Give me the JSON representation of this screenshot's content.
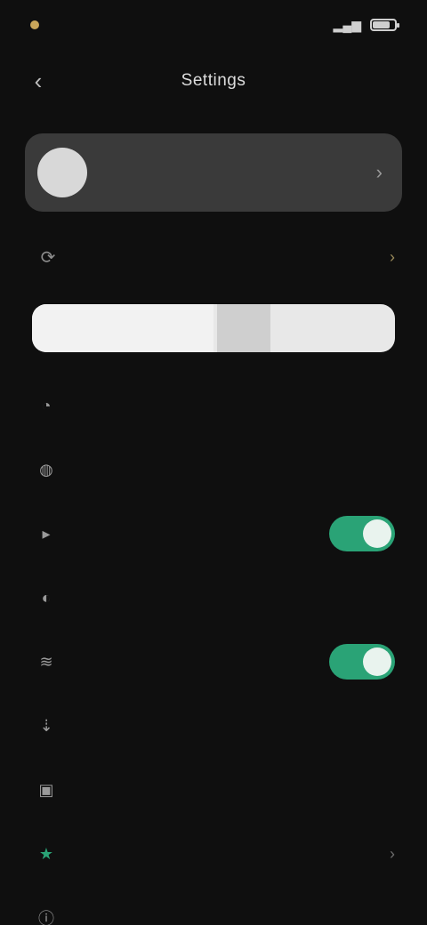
{
  "status_bar": {
    "time": "",
    "battery_level": 0.8
  },
  "header": {
    "title": "Settings",
    "back_icon": "arrow-left-icon"
  },
  "account": {
    "name": "",
    "chevron_icon": "chevron-right-icon"
  },
  "sync": {
    "title": "",
    "subtitle": "",
    "icon": "sync-icon"
  },
  "storage": {
    "used_fraction": 0.5
  },
  "settings": [
    {
      "id": "notifications",
      "icon": "bell-icon",
      "label": "",
      "value": "",
      "control": "none"
    },
    {
      "id": "language",
      "icon": "globe-icon",
      "label": "",
      "value": "",
      "control": "value"
    },
    {
      "id": "auto-play",
      "icon": "play-icon",
      "label": "",
      "value": "",
      "control": "toggle",
      "toggle_on": true
    },
    {
      "id": "theme",
      "icon": "moon-icon",
      "label": "",
      "value": "",
      "control": "value"
    },
    {
      "id": "haptics",
      "icon": "vibrate-icon",
      "label": "",
      "value": "",
      "control": "toggle",
      "toggle_on": true
    },
    {
      "id": "downloads",
      "icon": "download-icon",
      "label": "",
      "value": "",
      "control": "none"
    },
    {
      "id": "privacy",
      "icon": "lock-icon",
      "label": "",
      "value": "",
      "control": "none"
    },
    {
      "id": "premium",
      "icon": "star-icon",
      "label": "",
      "value": "",
      "control": "chevron"
    },
    {
      "id": "about",
      "icon": "info-icon",
      "label": "",
      "value": "",
      "control": "none"
    }
  ],
  "colors": {
    "accent": "#2aa376",
    "background": "#0f0f0f",
    "card": "#3a3a3a"
  }
}
